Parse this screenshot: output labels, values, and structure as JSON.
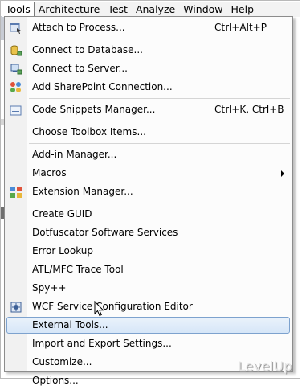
{
  "menubar": {
    "items": [
      {
        "label": "Tools",
        "active": true
      },
      {
        "label": "Architecture"
      },
      {
        "label": "Test"
      },
      {
        "label": "Analyze"
      },
      {
        "label": "Window"
      },
      {
        "label": "Help"
      }
    ]
  },
  "menu": {
    "items": [
      {
        "label": "Attach to Process...",
        "shortcut": "Ctrl+Alt+P",
        "icon": "attach-process-icon"
      },
      {
        "label": "Connect to Database...",
        "icon": "connect-database-icon"
      },
      {
        "label": "Connect to Server...",
        "icon": "connect-server-icon"
      },
      {
        "label": "Add SharePoint Connection...",
        "icon": "sharepoint-icon"
      },
      {
        "label": "Code Snippets Manager...",
        "shortcut": "Ctrl+K, Ctrl+B",
        "icon": "code-snippets-icon"
      },
      {
        "label": "Choose Toolbox Items..."
      },
      {
        "label": "Add-in Manager..."
      },
      {
        "label": "Macros",
        "submenu": true
      },
      {
        "label": "Extension Manager...",
        "icon": "extension-manager-icon"
      },
      {
        "label": "Create GUID"
      },
      {
        "label": "Dotfuscator Software Services"
      },
      {
        "label": "Error Lookup"
      },
      {
        "label": "ATL/MFC Trace Tool"
      },
      {
        "label": "Spy++"
      },
      {
        "label": "WCF Service Configuration Editor",
        "icon": "wcf-config-icon"
      },
      {
        "label": "External Tools...",
        "highlighted": true
      },
      {
        "label": "Import and Export Settings..."
      },
      {
        "label": "Customize..."
      },
      {
        "label": "Options..."
      }
    ]
  },
  "watermark": "LevelUp",
  "colors": {
    "highlight_border": "#7da2ce",
    "highlight_fill": "#d6e6f8",
    "gutter": "#f1f1f1"
  }
}
